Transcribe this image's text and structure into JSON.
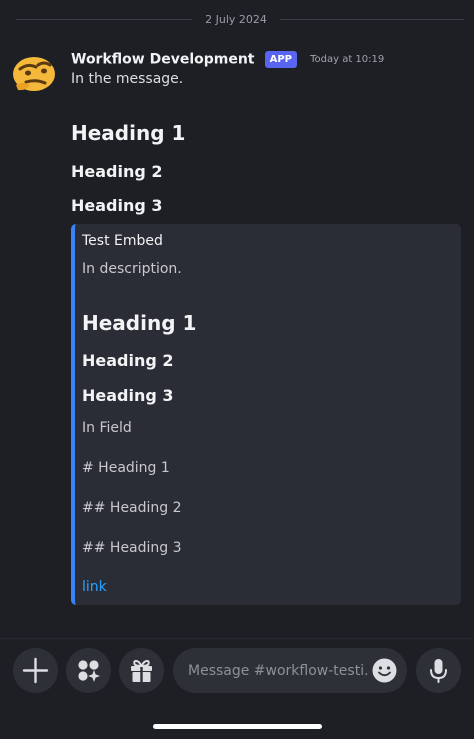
{
  "date_divider": "2 July 2024",
  "message": {
    "author": "Workflow Development",
    "badge": "APP",
    "timestamp": "Today at 10:19",
    "text": "In the message.",
    "headings": [
      "Heading 1",
      "Heading 2",
      "Heading 3"
    ]
  },
  "embed": {
    "title": "Test Embed",
    "description": "In description.",
    "field_headings": [
      "Heading 1",
      "Heading 2",
      "Heading 3"
    ],
    "field_text": "In Field",
    "raw_lines": [
      "# Heading 1",
      "## Heading 2",
      "## Heading 3"
    ],
    "link": "link",
    "accent_color": "#3b82f6"
  },
  "composer": {
    "placeholder": "Message #workflow-testi..."
  },
  "icons": {
    "avatar": "thinking-face-emoji-icon",
    "add": "plus-icon",
    "apps": "apps-icon",
    "gift": "gift-icon",
    "emoji": "emoji-icon",
    "mic": "microphone-icon"
  },
  "colors": {
    "background": "#1e1f25",
    "badge": "#5865f2",
    "link": "#28a3ff"
  }
}
